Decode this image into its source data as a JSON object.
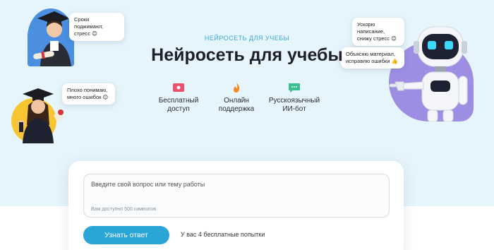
{
  "hero": {
    "kicker": "НЕЙРОСЕТЬ ДЛЯ УЧЕБЫ",
    "title": "Нейросеть для учебы"
  },
  "features": [
    {
      "icon": "card-icon",
      "color": "#ef4f6a",
      "line1": "Бесплатный",
      "line2": "доступ"
    },
    {
      "icon": "flame-icon",
      "color": "#f5891f",
      "line1": "Онлайн",
      "line2": "поддержка"
    },
    {
      "icon": "chat-icon",
      "color": "#3bbf8f",
      "line1": "Русскоязычный",
      "line2": "ИИ-бот"
    }
  ],
  "bubbles": {
    "top_left": {
      "line1": "Сроки поджимают,",
      "line2": "стресс 😊"
    },
    "mid_left": {
      "line1": "Плохо понимаю,",
      "line2": "много ошибок 😊"
    },
    "top_right": {
      "line1": "Ускорю написание,",
      "line2": "снижу стресс 😊"
    },
    "mid_right": {
      "line1": "Объясню материал,",
      "line2": "исправлю ошибки 👍"
    }
  },
  "form": {
    "placeholder": "Введите свой вопрос или тему работы",
    "counter": "Вам доступно 500 символов",
    "submit_label": "Узнать ответ",
    "attempts": "У вас 4 бесплатные попытки"
  },
  "colors": {
    "accent": "#2aa6d6",
    "hero_bg": "#e6f4fb",
    "robot_bg": "#9d8ee4"
  }
}
